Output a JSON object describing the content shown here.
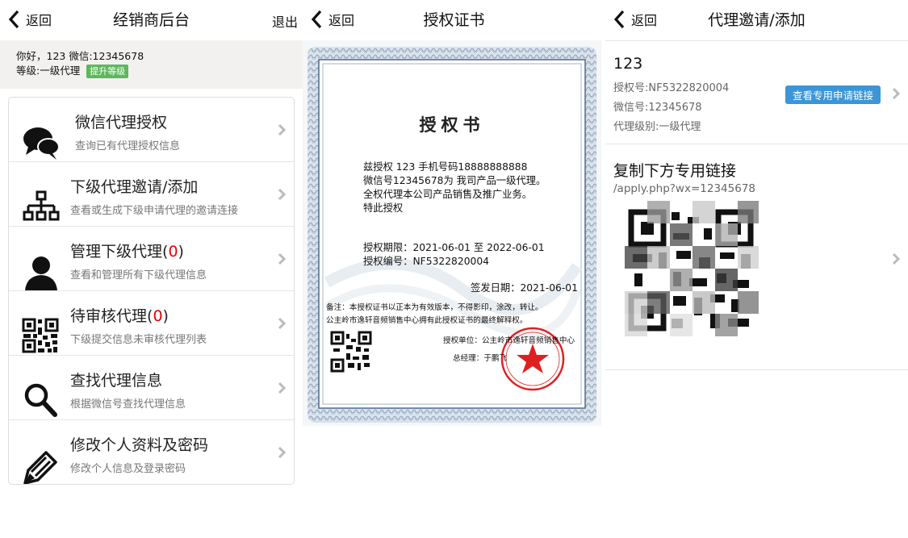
{
  "common": {
    "back_label": "返回"
  },
  "dealer": {
    "title": "经销商后台",
    "logout_label": "退出",
    "greeting": "你好，123  微信:12345678",
    "level": "等级:一级代理",
    "upgrade_label": "提升等级",
    "menu": [
      {
        "title": "微信代理授权",
        "count": null,
        "desc": "查询已有代理授权信息",
        "icon": "chat-bubbles-icon"
      },
      {
        "title": "下级代理邀请/添加",
        "count": null,
        "desc": "查看或生成下级申请代理的邀请连接",
        "icon": "org-chart-icon"
      },
      {
        "title": "管理下级代理",
        "count": "0",
        "desc": "查看和管理所有下级代理信息",
        "icon": "person-icon"
      },
      {
        "title": "待审核代理",
        "count": "0",
        "desc": "下级提交信息未审核代理列表",
        "icon": "qr-code-icon"
      },
      {
        "title": "查找代理信息",
        "count": null,
        "desc": "根据微信号查找代理信息",
        "icon": "search-icon"
      },
      {
        "title": "修改个人资料及密码",
        "count": null,
        "desc": "修改个人信息及登录密码",
        "icon": "pen-icon"
      }
    ]
  },
  "certificate_page": {
    "title": "授权证书",
    "cert": {
      "heading": "授权书",
      "line1": "兹授权  123   手机号码18888888888",
      "line2": "微信号12345678为 我司产品一级代理。",
      "line3": "全权代理本公司产品销售及推广业务。",
      "line4": "特此授权",
      "period": "授权期限：2021-06-01  至  2022-06-01",
      "number": "授权编号：NF5322820004",
      "issue_date": "签发日期：2021-06-01",
      "note1": "备注：本授权证书以正本为有效版本，不得影印，涂改，转让。",
      "note2": "公主岭市逸轩音频销售中心拥有此授权证书的最终解释权。",
      "unit": "授权单位：公主岭市逸轩音频销售中心",
      "manager": "总经理：于鹏飞",
      "seal_text": "公主岭市逸轩音频销售中心"
    }
  },
  "invite_page": {
    "title": "代理邀请/添加",
    "agent_name": "123",
    "auth_no": "授权号:NF5322820004",
    "wechat": "微信号:12345678",
    "level": "代理级别:一级代理",
    "link_button": "查看专用申请链接",
    "copy_title": "复制下方专用链接",
    "link_text": "/apply.php?wx=12345678"
  },
  "colors": {
    "accent_green": "#5cb85c",
    "accent_blue": "#3a96d8",
    "count_red": "#e60000",
    "seal_red": "#e02020"
  }
}
